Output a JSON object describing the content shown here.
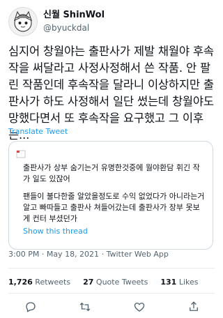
{
  "header": {
    "display_name": "신월 ShinWol",
    "handle": "@byuckdal"
  },
  "tweet": {
    "text": "심지어 창월야는 출판사가 제발 채월야 후속작을 써달라고 사정사정해서 쓴 작품. 안 팔린 작품인데 후속작을 달라니 이상하지만 출판사가 하도 사정해서 일단 썼는데 창월야도 망했다면서 또 후속작을 요구했고 그 이후는...",
    "translate_label": "Translate Tweet"
  },
  "quote": {
    "paragraph_1": "출판사가 상부 숨기는거 유명한것중에 월야환담 휘긴 작가 일도 있잖어",
    "paragraph_2": "팬들이 불다한줄 알았을정도로 수익 없었다가 아니라는거 알고 빠따들고 출판사 쳐들어갔는데 출판사가 장부 못보게 컨터 부셨던가",
    "show_thread": "Show this thread"
  },
  "meta": {
    "time": "3:00 PM",
    "date": "May 18, 2021",
    "source": "Twitter Web App",
    "separator": "·"
  },
  "stats": {
    "retweets_count": "1,726",
    "retweets_label": "Retweets",
    "quotes_count": "27",
    "quotes_label": "Quote Tweets",
    "likes_count": "131",
    "likes_label": "Likes"
  },
  "colors": {
    "accent": "#1d9bf0",
    "secondary_text": "#536471",
    "border": "#cfd9de"
  },
  "icons": [
    "reply-icon",
    "retweet-icon",
    "like-icon",
    "share-icon"
  ]
}
